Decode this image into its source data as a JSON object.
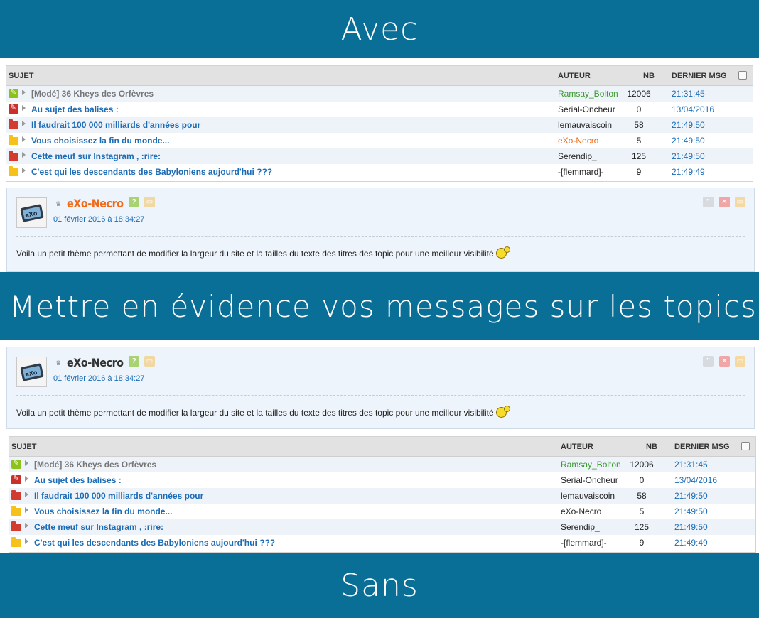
{
  "banners": {
    "top": "Avec",
    "middle": "Mettre en évidence vos messages sur les topics",
    "bottom": "Sans"
  },
  "table_header": {
    "sujet": "SUJET",
    "auteur": "AUTEUR",
    "nb": "NB",
    "dernier": "DERNIER MSG"
  },
  "table_avec": {
    "rows": [
      {
        "icon": "pin-icon-green",
        "title": "[Modé] 36 Kheys des Orfèvres",
        "author": "Ramsay_Bolton",
        "nb": "12006",
        "date": "21:31:45"
      },
      {
        "icon": "pin-icon-red",
        "title": "Au sujet des balises :",
        "author": "Serial-Oncheur",
        "nb": "0",
        "date": "13/04/2016"
      },
      {
        "icon": "folder-icon-red",
        "title": "Il faudrait 100 000 milliards d'années pour",
        "author": "lemauvaiscoin",
        "nb": "58",
        "date": "21:49:50"
      },
      {
        "icon": "folder-icon-yellow",
        "title": "Vous choisissez la fin du monde...",
        "author": "eXo-Necro",
        "nb": "5",
        "date": "21:49:50"
      },
      {
        "icon": "folder-icon-red",
        "title": "Cette meuf sur Instagram , :rire:",
        "author": "Serendip_",
        "nb": "125",
        "date": "21:49:50"
      },
      {
        "icon": "folder-icon-yellow",
        "title": "C'est qui les descendants des Babyloniens aujourd'hui ???",
        "author": "-[flemmard]-",
        "nb": "9",
        "date": "21:49:49"
      }
    ]
  },
  "table_sans": {
    "rows": [
      {
        "icon": "pin-icon-green",
        "title": "[Modé] 36 Kheys des Orfèvres",
        "author": "Ramsay_Bolton",
        "nb": "12006",
        "date": "21:31:45"
      },
      {
        "icon": "pin-icon-red",
        "title": "Au sujet des balises :",
        "author": "Serial-Oncheur",
        "nb": "0",
        "date": "13/04/2016"
      },
      {
        "icon": "folder-icon-red",
        "title": "Il faudrait 100 000 milliards d'années pour",
        "author": "lemauvaiscoin",
        "nb": "58",
        "date": "21:49:50"
      },
      {
        "icon": "folder-icon-yellow",
        "title": "Vous choisissez la fin du monde...",
        "author": "eXo-Necro",
        "nb": "5",
        "date": "21:49:50"
      },
      {
        "icon": "folder-icon-red",
        "title": "Cette meuf sur Instagram , :rire:",
        "author": "Serendip_",
        "nb": "125",
        "date": "21:49:50"
      },
      {
        "icon": "folder-icon-yellow",
        "title": "C'est qui les descendants des Babyloniens aujourd'hui ???",
        "author": "-[flemmard]-",
        "nb": "9",
        "date": "21:49:49"
      }
    ]
  },
  "post": {
    "pseudo": "eXo-Necro",
    "date": "01 février 2016 à 18:34:27",
    "text": "Voila un petit thème permettant de modifier la largeur du site et la tailles du texte des titres des topic pour une meilleur visibilité"
  },
  "colors": {
    "banner": "#0a6f97",
    "link_blue": "#1b6bb5",
    "highlight_orange": "#f06a1a",
    "mod_author_green": "#3a9a2e",
    "pin_green": "#8bc21c",
    "pin_red": "#c9302c",
    "folder_red": "#d23b2f",
    "folder_yellow": "#f6c21a"
  }
}
